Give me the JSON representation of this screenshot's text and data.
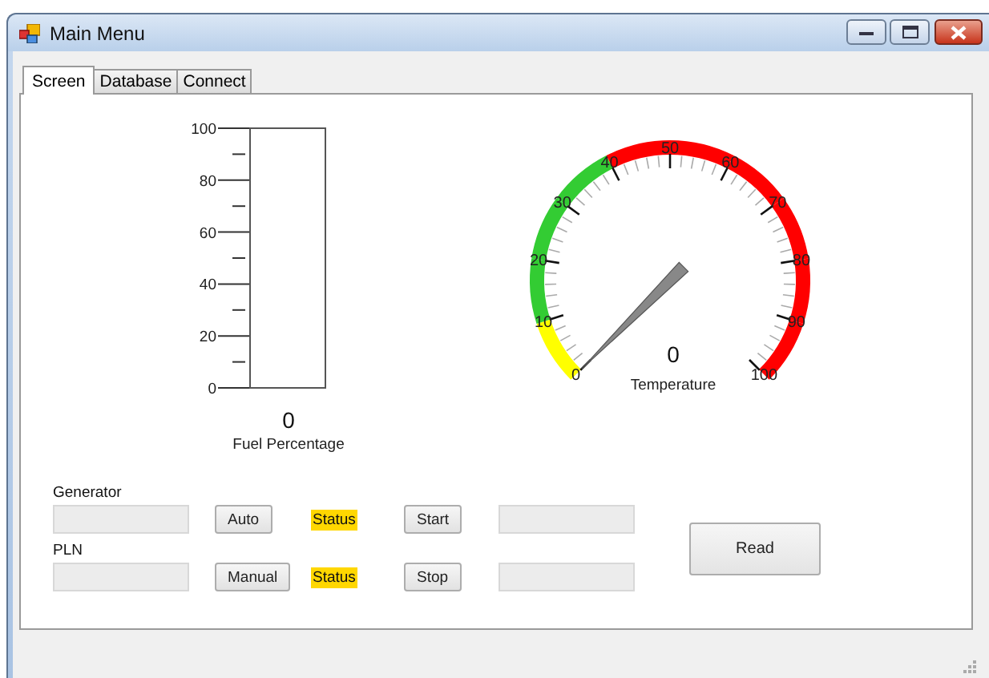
{
  "window": {
    "title": "Main Menu"
  },
  "tabs": [
    {
      "label": "Screen",
      "selected": true
    },
    {
      "label": "Database",
      "selected": false
    },
    {
      "label": "Connect",
      "selected": false
    }
  ],
  "fuel_gauge": {
    "ticks": [
      "100",
      "80",
      "60",
      "40",
      "20",
      "0"
    ],
    "reading": "0",
    "caption": "Fuel Percentage"
  },
  "temperature_gauge": {
    "ticks": [
      {
        "label": "0",
        "color": "#ffff00"
      },
      {
        "label": "10",
        "color": "#33cc33"
      },
      {
        "label": "20",
        "color": "#33cc33"
      },
      {
        "label": "30",
        "color": "#33cc33"
      },
      {
        "label": "40",
        "color": "#ff0000"
      },
      {
        "label": "50",
        "color": "#ff0000"
      },
      {
        "label": "60",
        "color": "#ff0000"
      },
      {
        "label": "70",
        "color": "#ff0000"
      },
      {
        "label": "80",
        "color": "#ff0000"
      },
      {
        "label": "90",
        "color": "#ff0000"
      },
      {
        "label": "100"
      }
    ],
    "reading": "0",
    "caption": "Temperature"
  },
  "rows": [
    {
      "label": "Generator",
      "mode_button": "Auto",
      "status": "Status",
      "action_button": "Start"
    },
    {
      "label": "PLN",
      "mode_button": "Manual",
      "status": "Status",
      "action_button": "Stop"
    }
  ],
  "read_button": "Read"
}
